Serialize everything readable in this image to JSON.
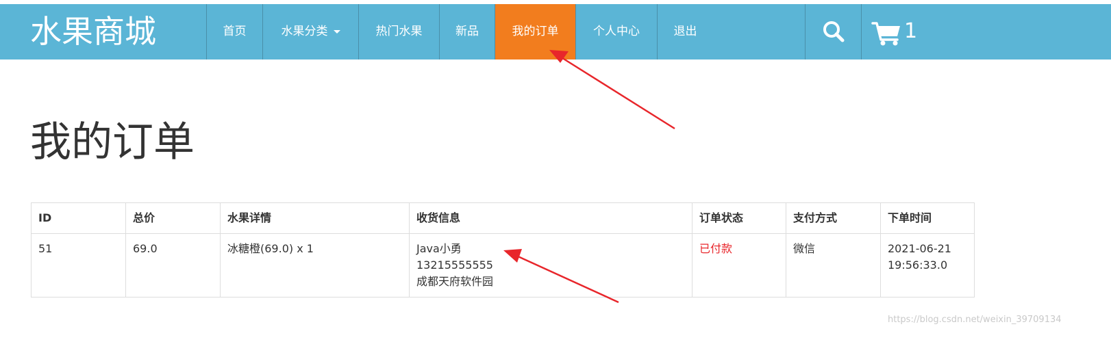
{
  "brand": "水果商城",
  "nav": {
    "items": [
      {
        "label": "首页"
      },
      {
        "label": "水果分类"
      },
      {
        "label": "热门水果"
      },
      {
        "label": "新品"
      },
      {
        "label": "我的订单"
      },
      {
        "label": "个人中心"
      },
      {
        "label": "退出"
      }
    ],
    "active_item": "我的订单",
    "cart_count": "1"
  },
  "page_title": "我的订单",
  "orders_table": {
    "headers": [
      "ID",
      "总价",
      "水果详情",
      "收货信息",
      "订单状态",
      "支付方式",
      "下单时间"
    ],
    "rows": [
      {
        "id": "51",
        "total": "69.0",
        "detail": "冰糖橙(69.0) x 1",
        "recipient_name": "Java小勇",
        "recipient_phone": "13215555555",
        "recipient_address": "成都天府软件园",
        "status": "已付款",
        "payment": "微信",
        "order_date": "2021-06-21",
        "order_time": "19:56:33.0"
      }
    ]
  },
  "watermark": "https://blog.csdn.net/weixin_39709134",
  "colors": {
    "navbar": "#5bb5d6",
    "active_nav": "#f27d1e",
    "status_paid": "#e8262b",
    "annotation_arrow": "#e8262b"
  },
  "icons": {
    "search": "search-icon",
    "cart": "cart-icon",
    "dropdown": "caret-down-icon"
  }
}
